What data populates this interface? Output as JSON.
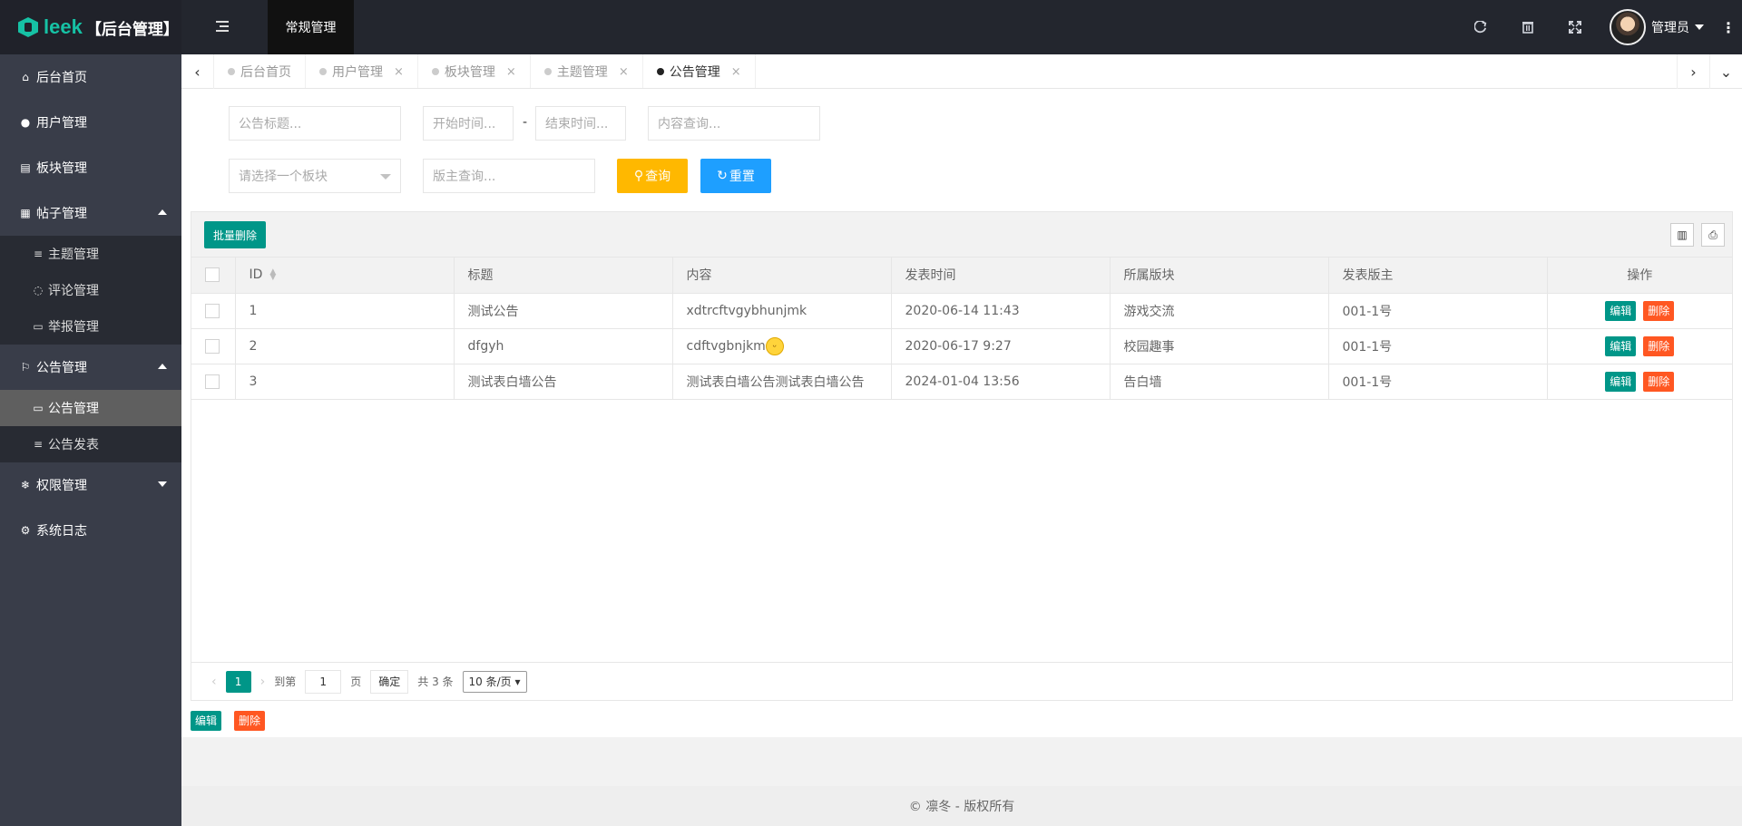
{
  "header": {
    "logo_text": "leek",
    "app_title": "【后台管理】",
    "top_nav_label": "常规管理",
    "user_name": "管理员",
    "icons": [
      "refresh-icon",
      "trash-icon",
      "fullscreen-icon"
    ]
  },
  "sidebar": {
    "items": [
      {
        "label": "后台首页",
        "icon": "home-icon"
      },
      {
        "label": "用户管理",
        "icon": "user-icon"
      },
      {
        "label": "板块管理",
        "icon": "file-icon"
      },
      {
        "label": "帖子管理",
        "icon": "calendar-icon",
        "children": [
          {
            "label": "主题管理",
            "icon": "list-icon"
          },
          {
            "label": "评论管理",
            "icon": "comment-icon"
          },
          {
            "label": "举报管理",
            "icon": "table-icon"
          }
        ]
      },
      {
        "label": "公告管理",
        "icon": "flag-icon",
        "children": [
          {
            "label": "公告管理",
            "icon": "table-icon",
            "active": true
          },
          {
            "label": "公告发表",
            "icon": "list-icon"
          }
        ]
      },
      {
        "label": "权限管理",
        "icon": "snowflake-icon"
      },
      {
        "label": "系统日志",
        "icon": "cogs-icon"
      }
    ]
  },
  "tabs": [
    {
      "label": "后台首页",
      "closable": false
    },
    {
      "label": "用户管理",
      "closable": true
    },
    {
      "label": "板块管理",
      "closable": true
    },
    {
      "label": "主题管理",
      "closable": true
    },
    {
      "label": "公告管理",
      "closable": true,
      "active": true
    }
  ],
  "search": {
    "title_placeholder": "公告标题...",
    "start_placeholder": "开始时间...",
    "dash": "-",
    "end_placeholder": "结束时间...",
    "content_placeholder": "内容查询...",
    "board_select": "请选择一个板块",
    "moderator_placeholder": "版主查询...",
    "query_label": "查询",
    "reset_label": "重置"
  },
  "table": {
    "batch_delete_label": "批量删除",
    "columns": [
      "ID",
      "标题",
      "内容",
      "发表时间",
      "所属版块",
      "发表版主",
      "操作"
    ],
    "rows": [
      {
        "id": "1",
        "title": "测试公告",
        "content": "xdtrcftvgybhunjmk",
        "time": "2020-06-14 11:43",
        "board": "游戏交流",
        "author": "001-1号"
      },
      {
        "id": "2",
        "title": "dfgyh",
        "content": "cdftvgbnjkm",
        "time": "2020-06-17 9:27",
        "board": "校园趣事",
        "author": "001-1号"
      },
      {
        "id": "3",
        "title": "测试表白墙公告",
        "content": "测试表白墙公告测试表白墙公告",
        "time": "2024-01-04 13:56",
        "board": "告白墙",
        "author": "001-1号"
      }
    ],
    "edit_label": "编辑",
    "delete_label": "删除"
  },
  "pager": {
    "current_page": "1",
    "goto_label": "到第",
    "goto_value": "1",
    "page_unit": "页",
    "confirm_label": "确定",
    "total_label": "共 3 条",
    "page_size": "10 条/页"
  },
  "bottom_buttons": {
    "edit": "编辑",
    "delete": "删除"
  },
  "footer": {
    "text": "© 凛冬 - 版权所有"
  }
}
